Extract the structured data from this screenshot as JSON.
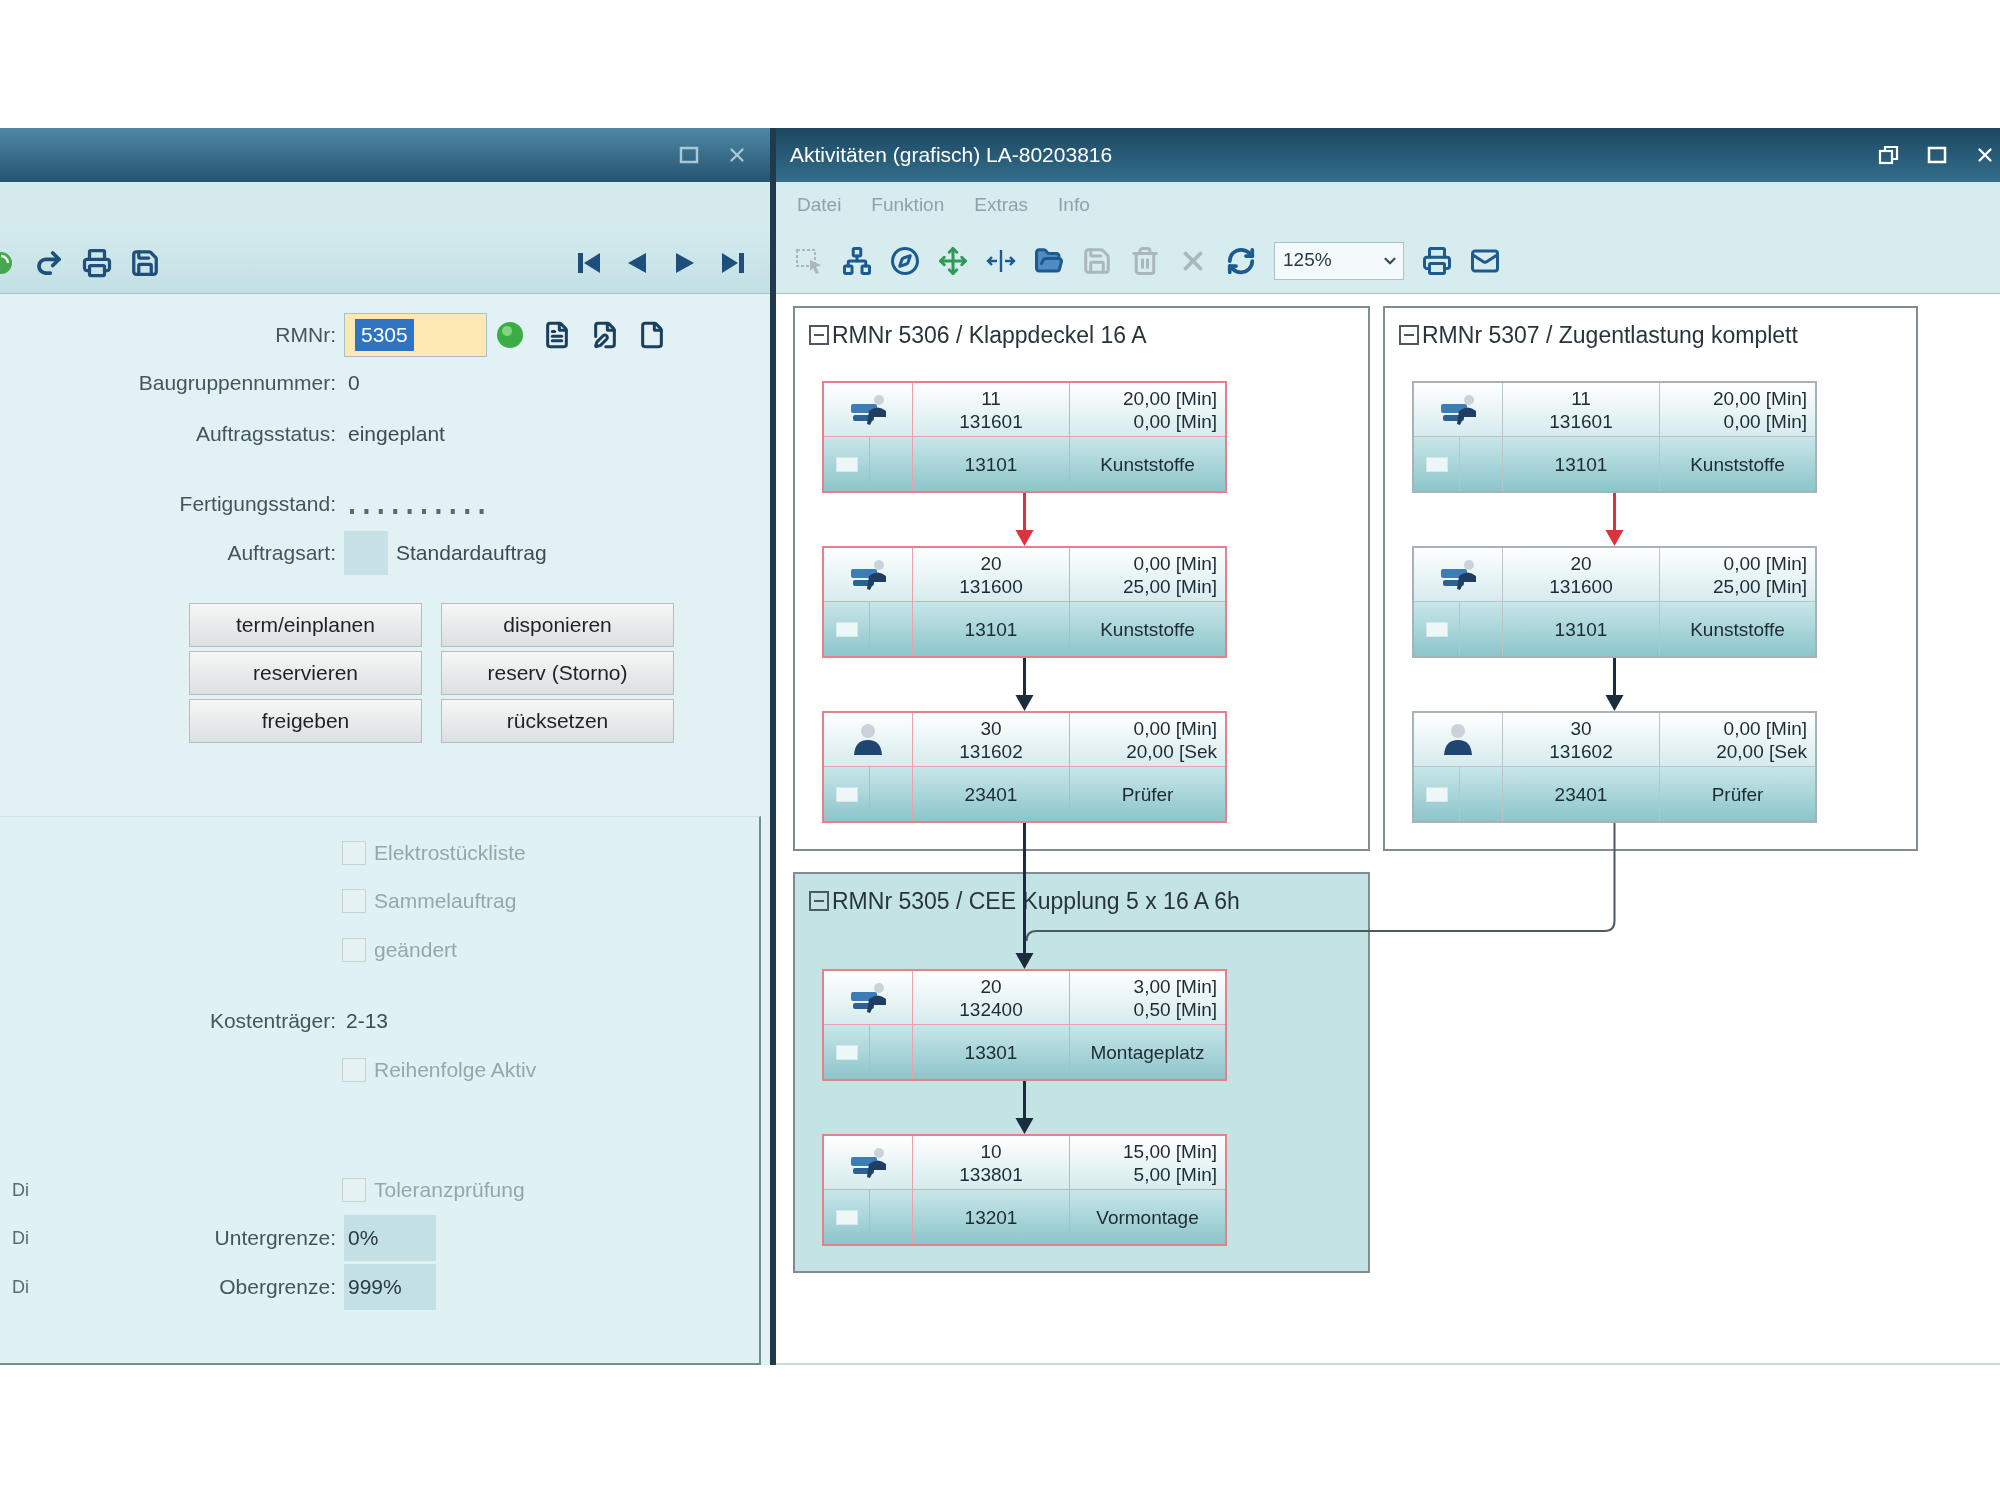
{
  "left_window": {
    "toolbar": [
      {
        "kind": "refresh"
      },
      {
        "kind": "redo"
      },
      {
        "kind": "print"
      },
      {
        "kind": "save"
      }
    ],
    "navigation": [
      {
        "kind": "first"
      },
      {
        "kind": "previous"
      },
      {
        "kind": "next"
      },
      {
        "kind": "last"
      }
    ],
    "record": {
      "label": "RMNr:",
      "value": "5305",
      "text_selected": true
    },
    "fields": [
      {
        "kind": "text",
        "label": "Baugruppennummer:",
        "value": "0"
      },
      {
        "kind": "text",
        "label": "Auftragsstatus:",
        "value": "eingeplant"
      },
      {
        "kind": "dots",
        "label": "Fertigungsstand:"
      },
      {
        "kind": "box",
        "label": "Auftragsart:",
        "value": "Standardauftrag"
      }
    ],
    "buttons": [
      "term/einplanen",
      "disponieren",
      "reservieren",
      "reserv (Storno)",
      "freigeben",
      "rücksetzen"
    ],
    "options": [
      {
        "kind": "checkbox",
        "label": "Elektrostückliste",
        "checked": false,
        "disabled": true
      },
      {
        "kind": "checkbox",
        "label": "Sammelauftrag",
        "checked": false,
        "disabled": true
      },
      {
        "kind": "checkbox",
        "label": "geändert",
        "checked": false,
        "disabled": true
      },
      {
        "kind": "text",
        "label": "Kostenträger:",
        "value": "2-13"
      },
      {
        "kind": "checkbox",
        "label": "Reihenfolge Aktiv",
        "checked": false,
        "disabled": true
      },
      {
        "kind": "checkbox",
        "label": "Toleranzprüfung",
        "checked": false,
        "disabled": true,
        "side_label": "Di"
      },
      {
        "kind": "input",
        "label": "Untergrenze:",
        "value": "0%",
        "side_label": "Di"
      },
      {
        "kind": "input",
        "label": "Obergrenze:",
        "value": "999%",
        "side_label": "Di"
      }
    ]
  },
  "right_window": {
    "title": "Aktivitäten (grafisch) LA-80203816",
    "menu": [
      "Datei",
      "Funktion",
      "Extras",
      "Info"
    ],
    "toolbar": [
      {
        "kind": "select",
        "disabled": true
      },
      {
        "kind": "tree",
        "disabled": false
      },
      {
        "kind": "compass",
        "disabled": false
      },
      {
        "kind": "move",
        "disabled": false
      },
      {
        "kind": "spread",
        "disabled": false
      },
      {
        "kind": "folder",
        "disabled": false
      },
      {
        "kind": "save",
        "disabled": true
      },
      {
        "kind": "delete",
        "disabled": true
      },
      {
        "kind": "cancel",
        "disabled": true
      },
      {
        "kind": "refresh",
        "disabled": false
      },
      {
        "kind": "zoom",
        "value": "125%"
      },
      {
        "kind": "print",
        "disabled": false
      },
      {
        "kind": "mail",
        "disabled": false
      }
    ],
    "diagram": {
      "groups": [
        {
          "title": "RMNr 5306 / Klappdeckel 16 A",
          "expanded": true,
          "selected": false,
          "nodes": [
            {
              "kind": "machine",
              "number": "11",
              "code": "131601",
              "time_1": "20,00 [Min]",
              "time_2": "0,00 [Min]",
              "station": "13101",
              "name": "Kunststoffe",
              "marked": true
            },
            {
              "kind": "machine",
              "number": "20",
              "code": "131600",
              "time_1": "0,00 [Min]",
              "time_2": "25,00 [Min]",
              "station": "13101",
              "name": "Kunststoffe",
              "marked": true,
              "arrow": {
                "color": "#e0303c"
              }
            },
            {
              "kind": "worker",
              "number": "30",
              "code": "131602",
              "time_1": "0,00 [Min]",
              "time_2": "20,00 [Sek",
              "station": "23401",
              "name": "Prüfer",
              "marked": true,
              "arrow": {
                "color": "#1b2c3c"
              }
            }
          ]
        },
        {
          "title": "RMNr 5307 / Zugentlastung komplett",
          "expanded": true,
          "selected": false,
          "nodes": [
            {
              "kind": "machine",
              "number": "11",
              "code": "131601",
              "time_1": "20,00 [Min]",
              "time_2": "0,00 [Min]",
              "station": "13101",
              "name": "Kunststoffe",
              "marked": false
            },
            {
              "kind": "machine",
              "number": "20",
              "code": "131600",
              "time_1": "0,00 [Min]",
              "time_2": "25,00 [Min]",
              "station": "13101",
              "name": "Kunststoffe",
              "marked": false,
              "arrow": {
                "color": "#e0303c"
              }
            },
            {
              "kind": "worker",
              "number": "30",
              "code": "131602",
              "time_1": "0,00 [Min]",
              "time_2": "20,00 [Sek",
              "station": "23401",
              "name": "Prüfer",
              "marked": false,
              "arrow": {
                "color": "#1b2c3c"
              }
            }
          ]
        },
        {
          "title": "RMNr 5305 / CEE Kupplung 5 x 16 A 6h",
          "expanded": true,
          "selected": true,
          "nodes": [
            {
              "kind": "machine",
              "number": "20",
              "code": "132400",
              "time_1": "3,00 [Min]",
              "time_2": "0,50 [Min]",
              "station": "13301",
              "name": "Montageplatz",
              "marked": true,
              "arrow": {
                "color": "#1b2c3c"
              }
            },
            {
              "kind": "machine",
              "number": "10",
              "code": "133801",
              "time_1": "15,00 [Min]",
              "time_2": "5,00 [Min]",
              "station": "13201",
              "name": "Vormontage",
              "marked": true,
              "arrow": {
                "color": "#1b2c3c"
              }
            }
          ]
        }
      ]
    }
  }
}
